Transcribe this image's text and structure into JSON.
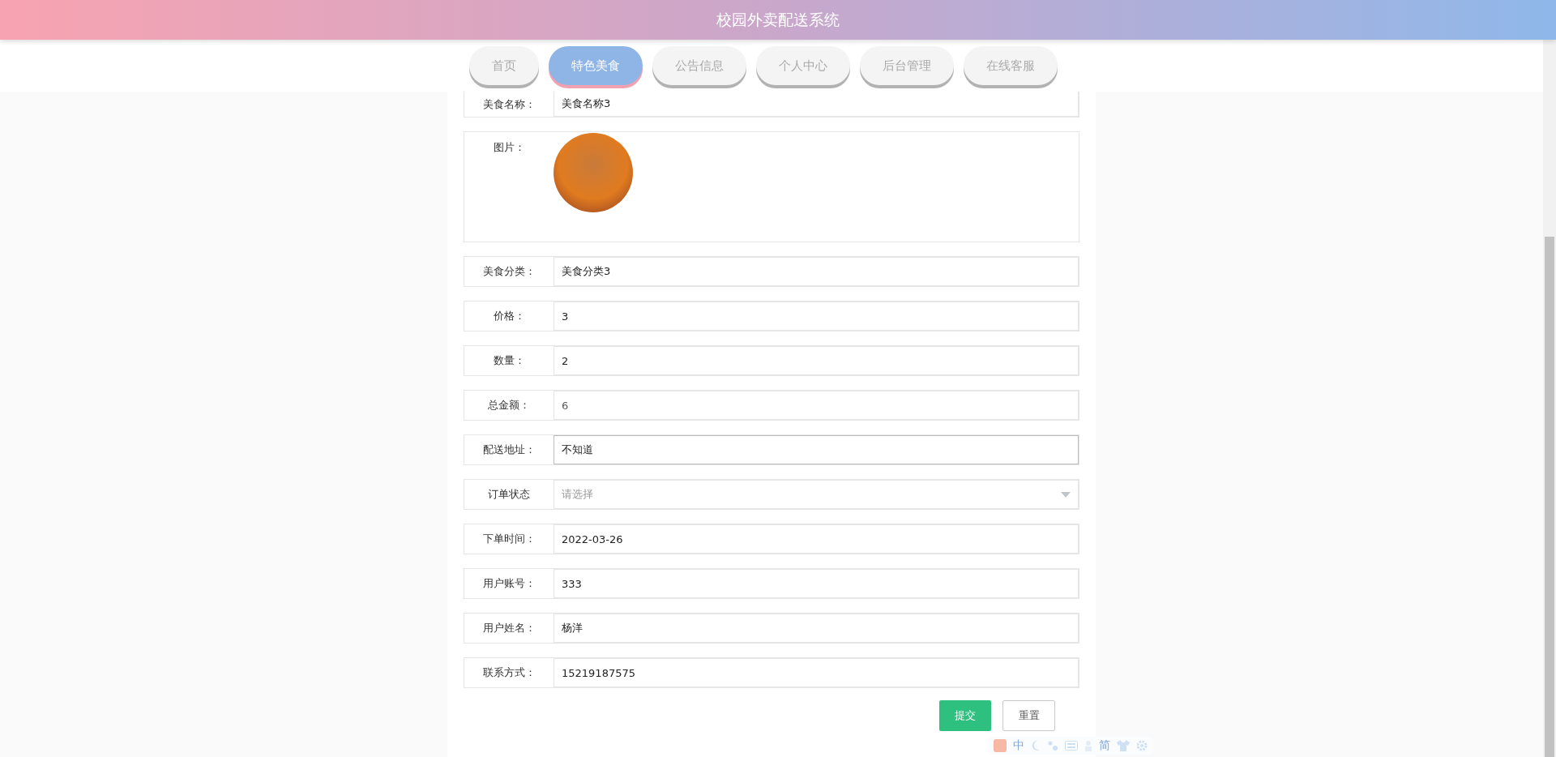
{
  "header": {
    "title": "校园外卖配送系统"
  },
  "nav": [
    {
      "label": "首页",
      "selected": false
    },
    {
      "label": "特色美食",
      "selected": true
    },
    {
      "label": "公告信息",
      "selected": false
    },
    {
      "label": "个人中心",
      "selected": false
    },
    {
      "label": "后台管理",
      "selected": false
    },
    {
      "label": "在线客服",
      "selected": false
    }
  ],
  "form": {
    "fields": [
      {
        "kind": "text",
        "label": "美食名称：",
        "value": "美食名称3",
        "disabled": false,
        "focused": false
      },
      {
        "kind": "image",
        "label": "图片："
      },
      {
        "kind": "text",
        "label": "美食分类：",
        "value": "美食分类3",
        "disabled": false,
        "focused": false
      },
      {
        "kind": "text",
        "label": "价格：",
        "value": "3",
        "disabled": false,
        "focused": false
      },
      {
        "kind": "text",
        "label": "数量：",
        "value": "2",
        "disabled": false,
        "focused": false
      },
      {
        "kind": "text",
        "label": "总金额：",
        "value": "6",
        "disabled": true,
        "focused": false
      },
      {
        "kind": "text",
        "label": "配送地址：",
        "value": "不知道",
        "disabled": false,
        "focused": true
      },
      {
        "kind": "select",
        "label": "订单状态",
        "placeholder": "请选择"
      },
      {
        "kind": "text",
        "label": "下单时间：",
        "value": "2022-03-26",
        "disabled": false,
        "focused": false
      },
      {
        "kind": "text",
        "label": "用户账号：",
        "value": "333",
        "disabled": false,
        "focused": false
      },
      {
        "kind": "text",
        "label": "用户姓名：",
        "value": "杨洋",
        "disabled": false,
        "focused": false
      },
      {
        "kind": "text",
        "label": "联系方式：",
        "value": "15219187575",
        "disabled": false,
        "focused": false
      }
    ]
  },
  "buttons": [
    {
      "kind": "primary",
      "label": "提交"
    },
    {
      "kind": "secondary",
      "label": "重置"
    }
  ],
  "ime_toolbar": {
    "mode": "中",
    "script": "简"
  }
}
